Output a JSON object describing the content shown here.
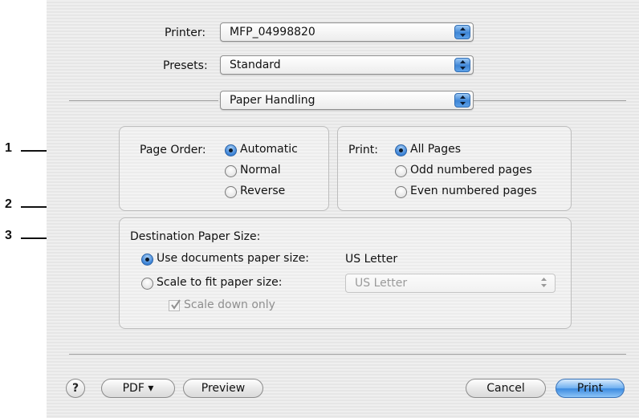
{
  "print_settings": {
    "printer_label": "Printer:",
    "printer_value": "MFP_04998820",
    "presets_label": "Presets:",
    "presets_value": "Standard",
    "pane_value": "Paper Handling"
  },
  "page_order": {
    "label": "Page Order:",
    "options": [
      "Automatic",
      "Normal",
      "Reverse"
    ],
    "selected": "Automatic"
  },
  "print_pages": {
    "label": "Print:",
    "options": [
      "All Pages",
      "Odd numbered pages",
      "Even numbered pages"
    ],
    "selected": "All Pages"
  },
  "destination": {
    "label": "Destination Paper Size:",
    "use_doc_label": "Use documents paper size:",
    "use_doc_value": "US Letter",
    "scale_label": "Scale to fit paper size:",
    "scale_value": "US Letter",
    "scale_down_label": "Scale down only",
    "selected": "use_documents"
  },
  "buttons": {
    "help": "?",
    "pdf": "PDF ▾",
    "preview": "Preview",
    "cancel": "Cancel",
    "print": "Print"
  },
  "callouts": [
    "1",
    "2",
    "3"
  ],
  "colors": {
    "accent": "#3b82d6",
    "background": "#ececec"
  }
}
